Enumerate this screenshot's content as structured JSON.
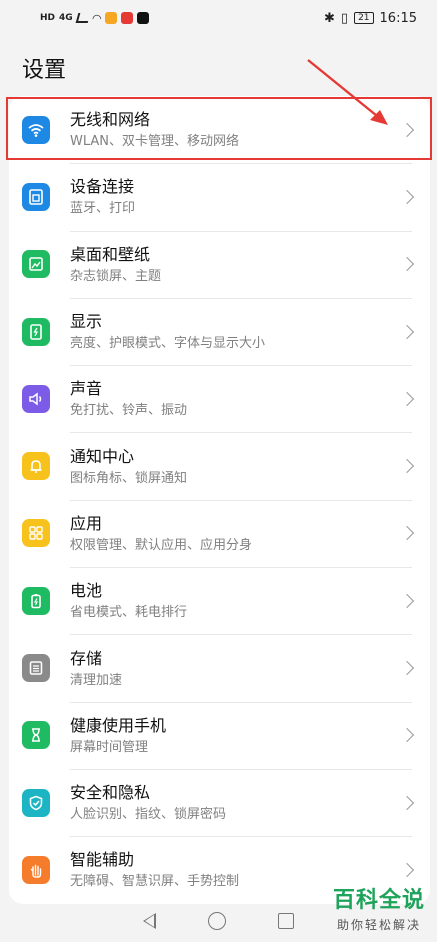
{
  "status_bar": {
    "left_icons": [
      "HD",
      "4G"
    ],
    "time": "16:15",
    "battery": "21"
  },
  "page_title": "设置",
  "items": [
    {
      "title": "无线和网络",
      "subtitle": "WLAN、双卡管理、移动网络",
      "icon": "wifi-icon",
      "color": "#1e88e5"
    },
    {
      "title": "设备连接",
      "subtitle": "蓝牙、打印",
      "icon": "device-connect-icon",
      "color": "#1e88e5"
    },
    {
      "title": "桌面和壁纸",
      "subtitle": "杂志锁屏、主题",
      "icon": "wallpaper-icon",
      "color": "#1fbb62"
    },
    {
      "title": "显示",
      "subtitle": "亮度、护眼模式、字体与显示大小",
      "icon": "display-icon",
      "color": "#1fbb62"
    },
    {
      "title": "声音",
      "subtitle": "免打扰、铃声、振动",
      "icon": "sound-icon",
      "color": "#7c5ce6"
    },
    {
      "title": "通知中心",
      "subtitle": "图标角标、锁屏通知",
      "icon": "bell-icon",
      "color": "#f7c21b"
    },
    {
      "title": "应用",
      "subtitle": "权限管理、默认应用、应用分身",
      "icon": "apps-icon",
      "color": "#f7c21b"
    },
    {
      "title": "电池",
      "subtitle": "省电模式、耗电排行",
      "icon": "battery-icon",
      "color": "#1fbb62"
    },
    {
      "title": "存储",
      "subtitle": "清理加速",
      "icon": "storage-icon",
      "color": "#8a8a8a"
    },
    {
      "title": "健康使用手机",
      "subtitle": "屏幕时间管理",
      "icon": "hourglass-icon",
      "color": "#1fbb62"
    },
    {
      "title": "安全和隐私",
      "subtitle": "人脸识别、指纹、锁屏密码",
      "icon": "shield-icon",
      "color": "#1db5c4"
    },
    {
      "title": "智能辅助",
      "subtitle": "无障碍、智慧识屏、手势控制",
      "icon": "hand-icon",
      "color": "#f57c2b"
    }
  ],
  "watermark": {
    "main": "百科全说",
    "sub": "助你轻松解决"
  },
  "colors": {
    "highlight": "#e53935",
    "background": "#f3f3f3"
  }
}
